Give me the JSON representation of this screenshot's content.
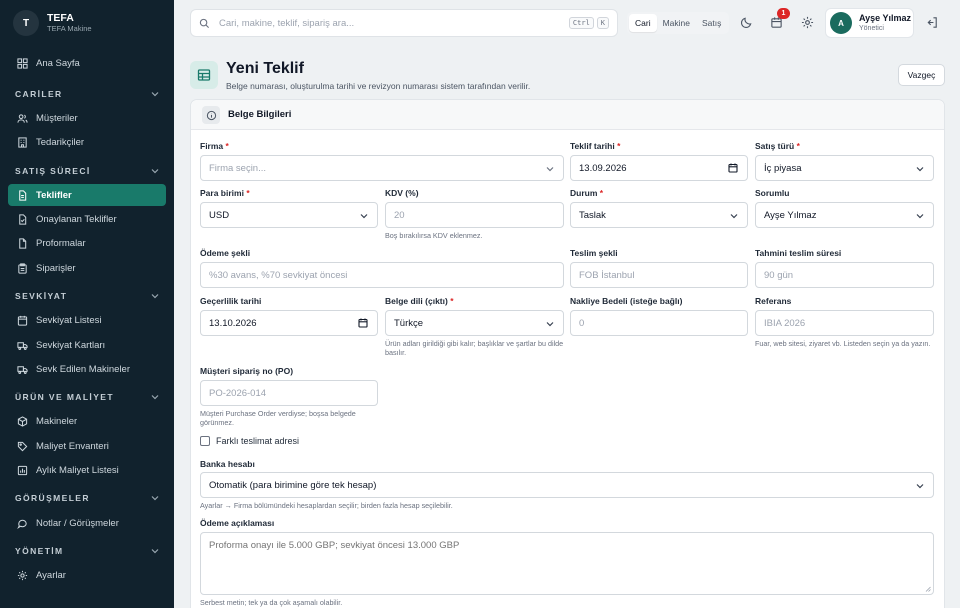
{
  "brand": {
    "initial": "T",
    "name": "TEFA",
    "subtitle": "TEFA Makine"
  },
  "sidebar": {
    "home": "Ana Sayfa",
    "sections": {
      "cariler": "CARİLER",
      "satis": "SATIŞ SÜRECİ",
      "sevkiyat": "SEVKİYAT",
      "urun": "ÜRÜN VE MALİYET",
      "gorusmeler": "GÖRÜŞMELER",
      "yonetim": "YÖNETİM"
    },
    "items": {
      "musteriler": "Müşteriler",
      "tedarikciler": "Tedarikçiler",
      "teklifler": "Teklifler",
      "onaylanan": "Onaylanan Teklifler",
      "proformalar": "Proformalar",
      "siparisler": "Siparişler",
      "sevkiyat_listesi": "Sevkiyat Listesi",
      "sevkiyat_kartlari": "Sevkiyat Kartları",
      "sevk_edilen": "Sevk Edilen Makineler",
      "makineler": "Makineler",
      "maliyet_envanteri": "Maliyet Envanteri",
      "aylik_maliyet": "Aylık Maliyet Listesi",
      "notlar": "Notlar / Görüşmeler",
      "ayarlar": "Ayarlar"
    }
  },
  "topbar": {
    "search_placeholder": "Cari, makine, teklif, sipariş ara...",
    "kbd_ctrl": "Ctrl",
    "kbd_k": "K",
    "segments": [
      "Cari",
      "Makine",
      "Satış"
    ],
    "notification_count": "1",
    "user_initial": "A",
    "user_name": "Ayşe Yılmaz",
    "user_role": "Yönetici"
  },
  "page": {
    "title": "Yeni Teklif",
    "subtitle": "Belge numarası, oluşturulma tarihi ve revizyon numarası sistem tarafından verilir.",
    "cancel": "Vazgeç"
  },
  "card": {
    "title": "Belge Bilgileri"
  },
  "form": {
    "firma": {
      "label": "Firma",
      "placeholder": "Firma seçin..."
    },
    "teklif_tarihi": {
      "label": "Teklif tarihi",
      "value": "13.09.2026"
    },
    "satis_turu": {
      "label": "Satış türü",
      "value": "İç piyasa"
    },
    "para_birimi": {
      "label": "Para birimi",
      "value": "USD"
    },
    "kdv": {
      "label": "KDV (%)",
      "placeholder": "20",
      "hint": "Boş bırakılırsa KDV eklenmez."
    },
    "durum": {
      "label": "Durum",
      "value": "Taslak"
    },
    "sorumlu": {
      "label": "Sorumlu",
      "value": "Ayşe Yılmaz"
    },
    "odeme_sekli": {
      "label": "Ödeme şekli",
      "placeholder": "%30 avans, %70 sevkiyat öncesi"
    },
    "teslim_sekli": {
      "label": "Teslim şekli",
      "placeholder": "FOB İstanbul"
    },
    "teslim_suresi": {
      "label": "Tahmini teslim süresi",
      "placeholder": "90 gün"
    },
    "gecerlilik": {
      "label": "Geçerlilik tarihi",
      "value": "13.10.2026"
    },
    "belge_dili": {
      "label": "Belge dili (çıktı)",
      "value": "Türkçe",
      "hint": "Ürün adları girildiği gibi kalır; başlıklar ve şartlar bu dilde basılır."
    },
    "nakliye": {
      "label": "Nakliye Bedeli (isteğe bağlı)",
      "placeholder": "0"
    },
    "referans": {
      "label": "Referans",
      "placeholder": "IBIA 2026",
      "hint": "Fuar, web sitesi, ziyaret vb. Listeden seçin ya da yazın."
    },
    "po": {
      "label": "Müşteri sipariş no (PO)",
      "placeholder": "PO-2026-014",
      "hint": "Müşteri Purchase Order verdiyse; boşsa belgede görünmez."
    },
    "farkli_teslimat": "Farklı teslimat adresi",
    "banka": {
      "label": "Banka hesabı",
      "value": "Otomatik (para birimine göre tek hesap)",
      "hint": "Ayarlar → Firma bölümündeki hesaplardan seçilir; birden fazla hesap seçilebilir."
    },
    "odeme_aciklamasi": {
      "label": "Ödeme açıklaması",
      "placeholder": "Proforma onayı ile 5.000 GBP; sevkiyat öncesi 13.000 GBP",
      "hint": "Serbest metin; tek ya da çok aşamalı olabilir."
    }
  },
  "colors": {
    "sidebar": "#11222d",
    "accent": "#197a6a",
    "required": "#dc2626"
  }
}
